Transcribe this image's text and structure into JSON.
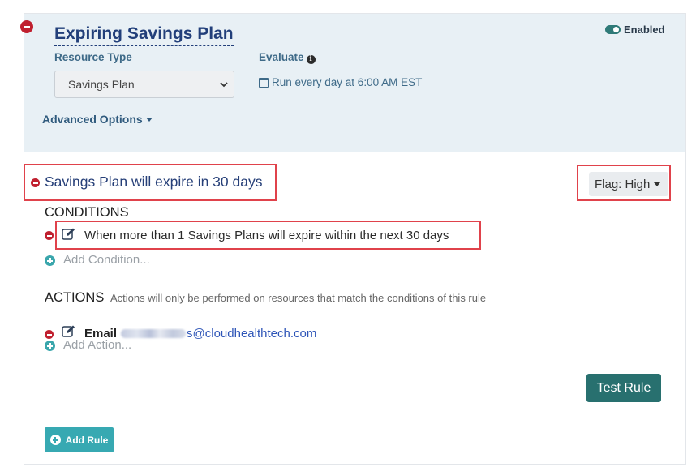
{
  "policy": {
    "title": "Expiring Savings Plan",
    "status_label": "Enabled",
    "resource_type_label": "Resource Type",
    "resource_type_value": "Savings Plan",
    "evaluate_label": "Evaluate",
    "schedule": "Run every day at 6:00 AM EST",
    "advanced_options_label": "Advanced Options"
  },
  "rule": {
    "title": "Savings Plan will expire in 30 days",
    "flag_label": "Flag: High",
    "conditions_heading": "CONDITIONS",
    "condition_text": "When more than 1 Savings Plans will expire within the next 30 days",
    "add_condition_label": "Add Condition...",
    "actions_heading": "ACTIONS",
    "actions_note": "Actions will only be performed on resources that match the conditions of this rule",
    "email_label": "Email",
    "email_domain": "s@cloudhealthtech.com",
    "add_action_label": "Add Action...",
    "test_rule_label": "Test Rule"
  },
  "add_rule_label": "Add Rule",
  "colors": {
    "header_background": "#e8f0f5",
    "title_navy": "#223f7a",
    "label_blue": "#3e6a88",
    "remove_red": "#c0202f",
    "teal_button": "#28706f",
    "add_teal": "#37a9b2",
    "highlight_red": "#e0424b"
  },
  "icons": [
    "minus-circle-icon",
    "toggle-on-icon",
    "info-icon",
    "calendar-icon",
    "chevron-down-icon",
    "edit-icon",
    "plus-circle-icon"
  ]
}
